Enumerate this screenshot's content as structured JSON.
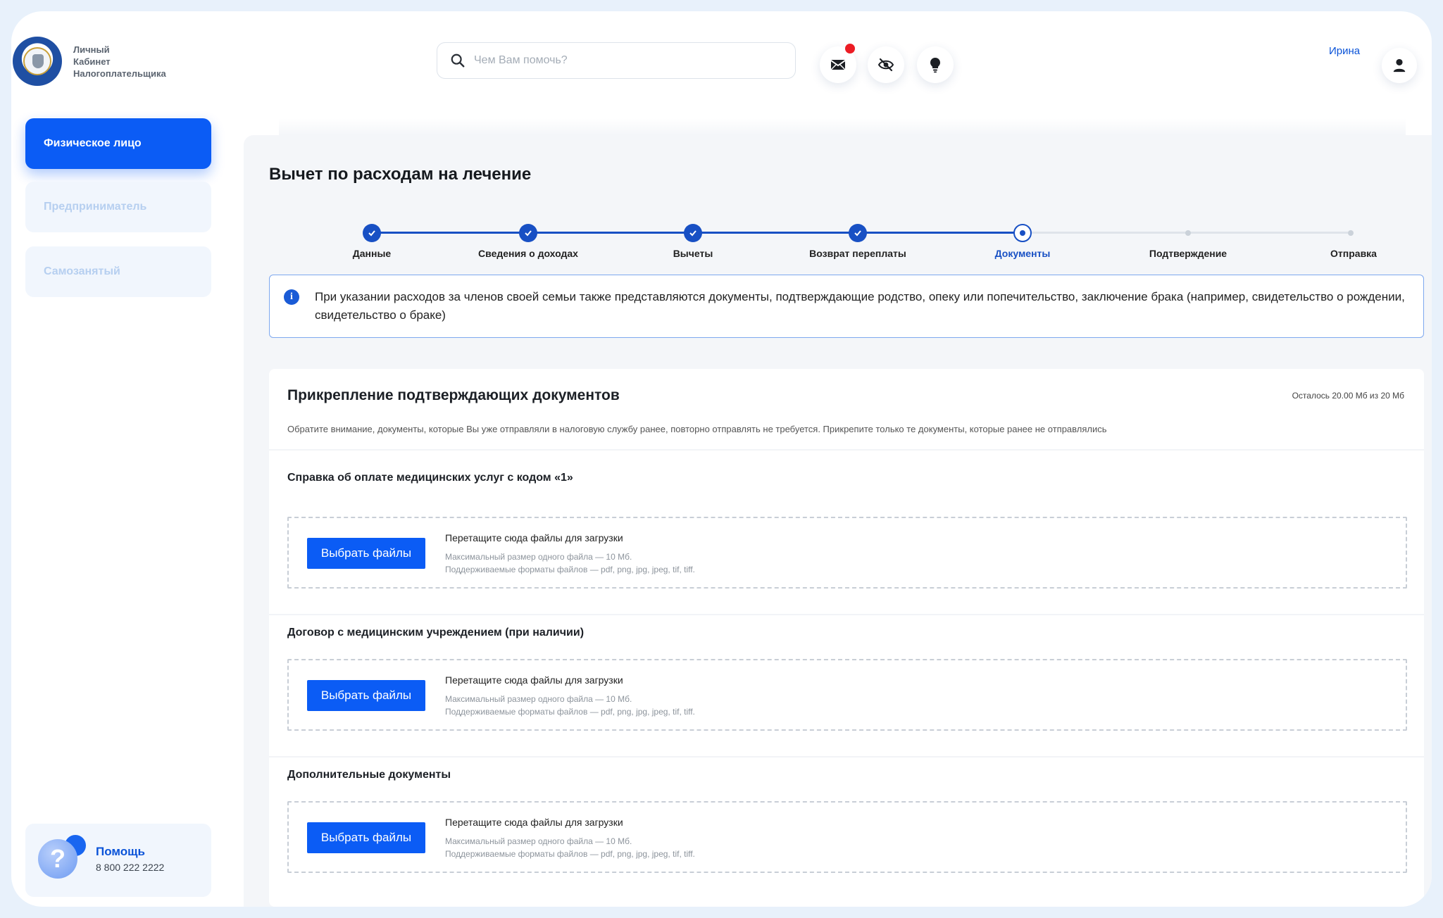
{
  "logo": {
    "line1": "Личный",
    "line2": "Кабинет",
    "line3": "Налогоплательщика"
  },
  "header": {
    "search_placeholder": "Чем Вам помочь?",
    "user_name": "Ирина",
    "icons": [
      "mail-icon",
      "hide-eye-icon",
      "lightbulb-icon",
      "user-icon"
    ],
    "mail_has_notification": true
  },
  "sidebar": {
    "items": [
      {
        "label": "Физическое лицо",
        "active": true
      },
      {
        "label": "Предприниматель",
        "active": false
      },
      {
        "label": "Самозанятый",
        "active": false
      }
    ],
    "help": {
      "title": "Помощь",
      "phone": "8 800 222 2222"
    }
  },
  "main": {
    "title": "Вычет по расходам на лечение",
    "steps": [
      {
        "label": "Данные",
        "state": "done"
      },
      {
        "label": "Сведения о доходах",
        "state": "done"
      },
      {
        "label": "Вычеты",
        "state": "done"
      },
      {
        "label": "Возврат переплаты",
        "state": "done"
      },
      {
        "label": "Документы",
        "state": "current"
      },
      {
        "label": "Подтверждение",
        "state": "todo"
      },
      {
        "label": "Отправка",
        "state": "todo"
      }
    ],
    "info_text": "При указании расходов за членов своей семьи также представляются документы, подтверждающие родство, опеку или попечительство, заключение брака (например, свидетельство о рождении, свидетельство о браке)",
    "card": {
      "title": "Прикрепление подтверждающих документов",
      "remaining": "Осталось 20.00 Мб из 20 Мб",
      "note": "Обратите внимание, документы, которые Вы уже отправляли в налоговую службу ранее, повторно отправлять не требуется. Прикрепите только те документы, которые ранее не отправлялись",
      "sections": [
        {
          "title": "Справка об оплате медицинских услуг с кодом «1»",
          "button": "Выбрать файлы",
          "drop_text": "Перетащите сюда файлы для загрузки",
          "max_size": "Максимальный размер одного файла — 10 Мб.",
          "formats": "Поддерживаемые форматы файлов — pdf, png, jpg, jpeg, tif, tiff."
        },
        {
          "title": "Договор с медицинским учреждением (при наличии)",
          "button": "Выбрать файлы",
          "drop_text": "Перетащите сюда файлы для загрузки",
          "max_size": "Максимальный размер одного файла — 10 Мб.",
          "formats": "Поддерживаемые форматы файлов — pdf, png, jpg, jpeg, tif, tiff."
        },
        {
          "title": "Дополнительные документы",
          "button": "Выбрать файлы",
          "drop_text": "Перетащите сюда файлы для загрузки",
          "max_size": "Максимальный размер одного файла — 10 Мб.",
          "formats": "Поддерживаемые форматы файлов — pdf, png, jpg, jpeg, tif, tiff."
        }
      ]
    }
  },
  "colors": {
    "primary": "#0b5cf5",
    "step_done": "#1850c4",
    "notification": "#ec1c24",
    "sidebar_inactive_bg": "#f1f6fd"
  }
}
